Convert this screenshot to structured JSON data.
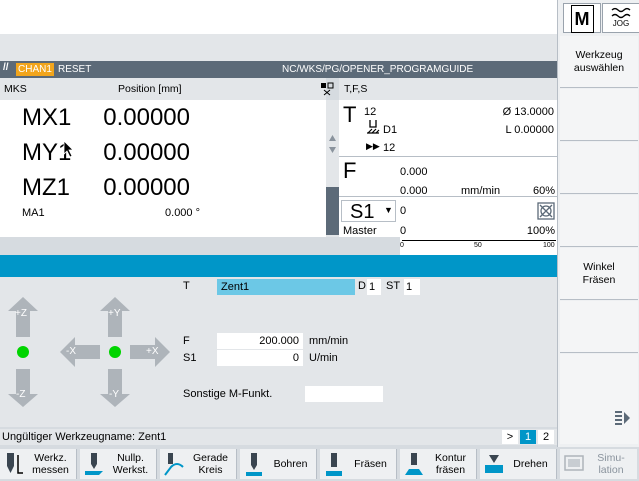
{
  "header": {
    "chan": "CHAN1",
    "reset": "RESET",
    "program": "NC/WKS/PG/OPENER_PROGRAMGUIDE"
  },
  "mode": {
    "machine": "M",
    "jog": "JOG"
  },
  "mks": {
    "title": "MKS",
    "position_label": "Position [mm]",
    "axes": [
      {
        "name": "MX1",
        "value": "0.00000"
      },
      {
        "name": "MY1",
        "value": "0.00000"
      },
      {
        "name": "MZ1",
        "value": "0.00000"
      }
    ],
    "ma1": {
      "name": "MA1",
      "value": "0.000 °"
    }
  },
  "tfs": {
    "title": "T,F,S",
    "tool": "12",
    "diameter": "Ø 13.0000",
    "d": "D1",
    "length": "L 0.00000",
    "st": "12",
    "f_value1": "0.000",
    "f_value2": "0.000",
    "f_unit": "mm/min",
    "f_percent": "60%",
    "s_label": "S1",
    "s_value": "0",
    "master": "Master",
    "master_value": "0",
    "master_percent": "100%",
    "scale": [
      "0",
      "50",
      "100"
    ]
  },
  "form": {
    "t_label": "T",
    "t_value": "Zent1",
    "d_label": "D",
    "d_value": "1",
    "st_label": "ST",
    "st_value": "1",
    "f_label": "F",
    "f_value": "200.000",
    "f_unit": "mm/min",
    "s1_label": "S1",
    "s1_value": "0",
    "s1_unit": "U/min",
    "mfunc_label": "Sonstige M-Funkt.",
    "mfunc_value": ""
  },
  "jog": {
    "zplus": "+Z",
    "zminus": "-Z",
    "yplus": "+Y",
    "yminus": "-Y",
    "xplus": "+X",
    "xminus": "-X"
  },
  "status": {
    "text": "Ungültiger Werkzeugname: Zent1",
    "page_more": ">",
    "page1": "1",
    "page2": "2"
  },
  "vsoftkeys": [
    {
      "label": "Werkzeug\nauswählen"
    },
    {
      "label": ""
    },
    {
      "label": ""
    },
    {
      "label": ""
    },
    {
      "label": "Winkel\nFräsen"
    },
    {
      "label": ""
    },
    {
      "label": ""
    }
  ],
  "hsoftkeys": [
    {
      "label": "Werkz.\nmessen"
    },
    {
      "label": "Nullp.\nWerkst."
    },
    {
      "label": "Gerade\nKreis"
    },
    {
      "label": "Bohren"
    },
    {
      "label": "Fräsen"
    },
    {
      "label": "Kontur\nfräsen"
    },
    {
      "label": "Drehen"
    },
    {
      "label": "Simu-\nlation"
    }
  ]
}
